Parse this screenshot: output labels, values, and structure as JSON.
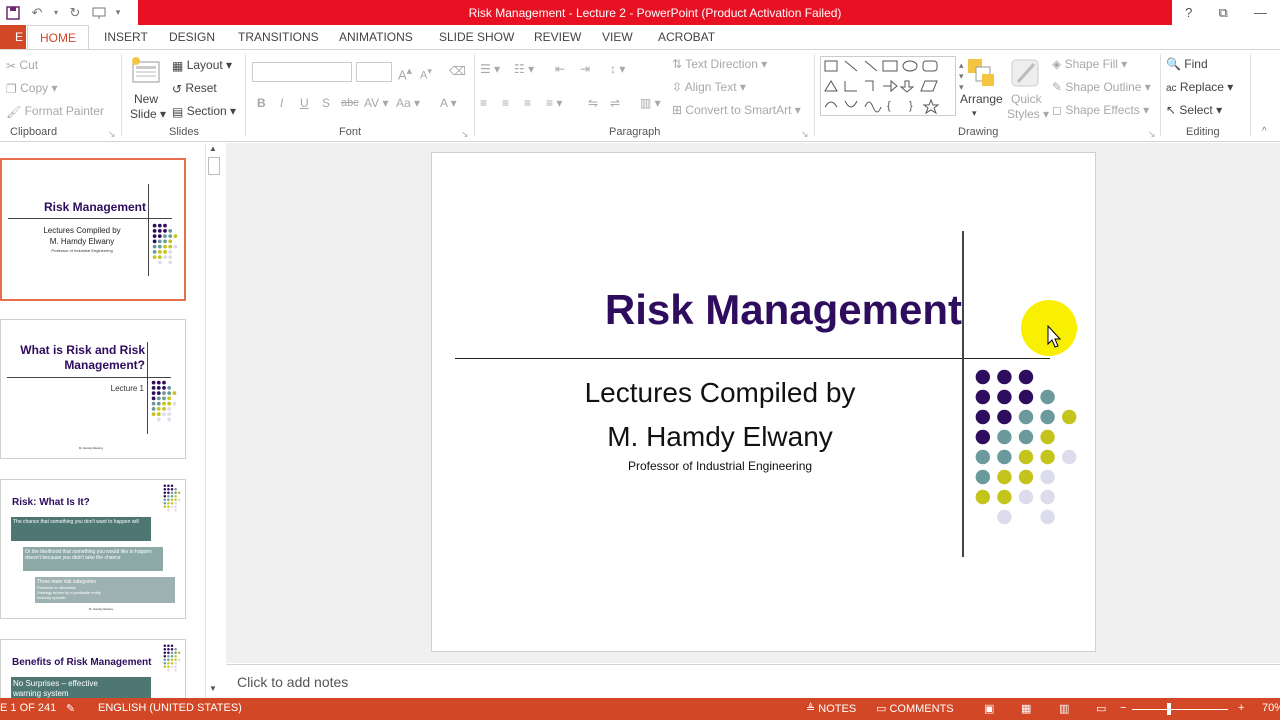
{
  "window": {
    "title": "Risk Management - Lecture 2 -  PowerPoint (Product Activation Failed)",
    "help": "?",
    "colors": {
      "accent": "#d24726",
      "titlebar": "#e81123",
      "title_purple": "#2e0c5e"
    }
  },
  "qat": {
    "icons": [
      "save-icon",
      "undo-icon",
      "redo-icon",
      "start-presentation-icon",
      "customize-qat-icon"
    ]
  },
  "tabs": {
    "file": "E",
    "items": [
      {
        "label": "HOME"
      },
      {
        "label": "INSERT"
      },
      {
        "label": "DESIGN"
      },
      {
        "label": "TRANSITIONS"
      },
      {
        "label": "ANIMATIONS"
      },
      {
        "label": "SLIDE SHOW"
      },
      {
        "label": "REVIEW"
      },
      {
        "label": "VIEW"
      },
      {
        "label": "ACROBAT"
      }
    ]
  },
  "ribbon": {
    "clipboard": {
      "cut": "Cut",
      "copy": "Copy",
      "format_painter": "Format Painter",
      "label": "Clipboard"
    },
    "slides": {
      "new_slide_1": "New",
      "new_slide_2": "Slide",
      "layout": "Layout",
      "reset": "Reset",
      "section": "Section",
      "label": "Slides"
    },
    "font": {
      "label": "Font",
      "bold": "B",
      "italic": "I",
      "underline": "U",
      "shadow": "S",
      "strike": "abc",
      "spacing": "AV",
      "case": "Aa",
      "color": "A",
      "grow": "A",
      "shrink": "A"
    },
    "paragraph": {
      "label": "Paragraph",
      "text_direction": "Text Direction",
      "align_text": "Align Text",
      "smartart": "Convert to SmartArt"
    },
    "drawing": {
      "label": "Drawing",
      "arrange": "Arrange",
      "quick_1": "Quick",
      "quick_2": "Styles",
      "shape_fill": "Shape Fill",
      "shape_outline": "Shape Outline",
      "shape_effects": "Shape Effects"
    },
    "editing": {
      "label": "Editing",
      "find": "Find",
      "replace": "Replace",
      "select": "Select"
    }
  },
  "thumbnails": [
    {
      "title": "Risk Management",
      "line1": "Lectures Compiled by",
      "line2": "M. Hamdy Elwany",
      "line3": "Professor of Industrial Engineering"
    },
    {
      "title1": "What is Risk and Risk",
      "title2": "Management?",
      "sub": "Lecture 1",
      "footer": "M. Hamdy Elwany"
    },
    {
      "title": "Risk:  What Is It?",
      "box1": "The chance that something you don't want to happen will",
      "box2": "Or the likelihood that something you would like to happen doesn't because you didn't take the chance",
      "box3": "Three main risk categories",
      "box3_items": [
        "Financial or otherwise",
        "Strategy driven by a profitable entity",
        "Industry specific"
      ],
      "footer": "M. Hamdy Elwany"
    },
    {
      "title": "Benefits of Risk Management",
      "box1a": "No Surprises – effective",
      "box1b": "warning system"
    }
  ],
  "slide": {
    "title": "Risk Management",
    "line1": "Lectures Compiled by",
    "line2": "M. Hamdy Elwany",
    "line3": "Professor of Industrial Engineering"
  },
  "notes": {
    "placeholder": "Click to add notes"
  },
  "status": {
    "slide": "E 1 OF 241",
    "language": "ENGLISH (UNITED STATES)",
    "notes": "NOTES",
    "comments": "COMMENTS",
    "zoom": "70%"
  }
}
